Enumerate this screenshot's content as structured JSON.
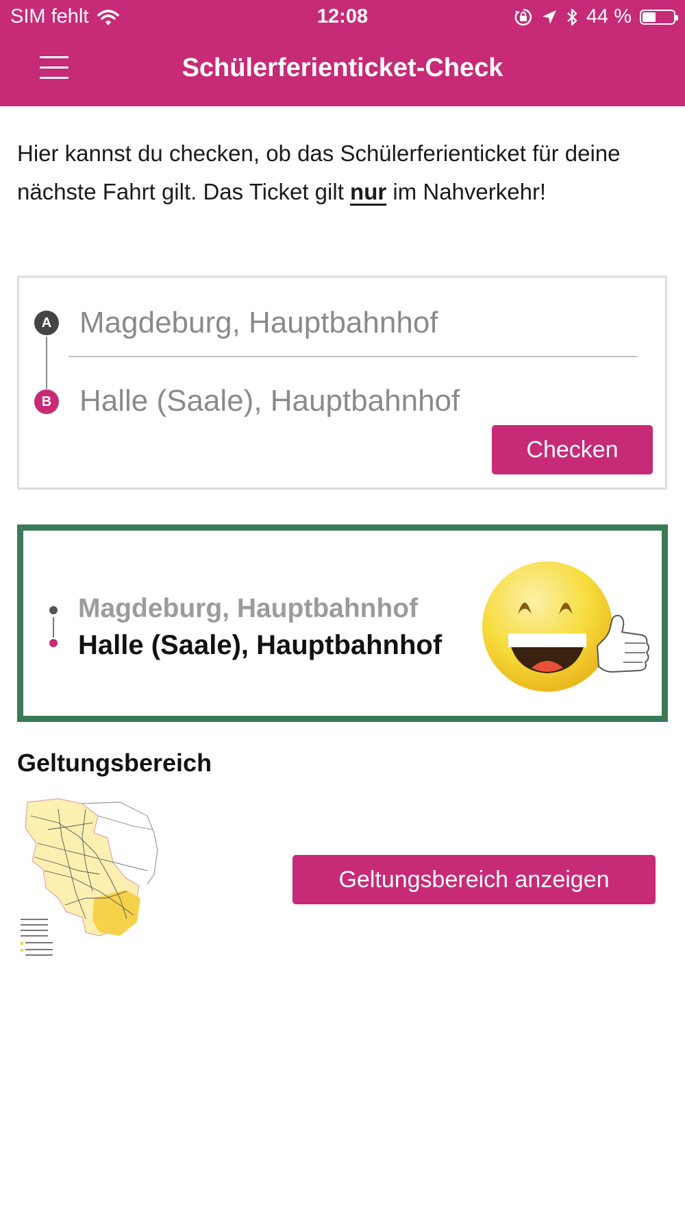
{
  "status_bar": {
    "carrier": "SIM fehlt",
    "time": "12:08",
    "battery_percent": "44 %",
    "battery_level": 0.44,
    "icons": [
      "wifi-icon",
      "rotation-lock-icon",
      "location-arrow-icon",
      "bluetooth-icon",
      "battery-icon"
    ]
  },
  "header": {
    "title": "Schülerferienticket-Check",
    "menu_icon": "hamburger-menu-icon"
  },
  "intro": {
    "text_before": "Hier kannst du checken, ob das Schülerferienticket für deine nächste Fahrt gilt. Das Ticket gilt ",
    "emphasis": "nur",
    "text_after": " im Nahverkehr!"
  },
  "route_form": {
    "marker_a": "A",
    "marker_b": "B",
    "from_value": "Magdeburg, Hauptbahnhof",
    "to_value": "Halle (Saale), Hauptbahnhof",
    "submit_label": "Checken"
  },
  "result": {
    "from": "Magdeburg, Hauptbahnhof",
    "to": "Halle (Saale), Hauptbahnhof",
    "status_icon": "laughing-thumbs-up-emoji-icon",
    "border_color": "#3b7a57"
  },
  "validity": {
    "title": "Geltungsbereich",
    "map_image": "validity-area-map-thumbnail",
    "button_label": "Geltungsbereich anzeigen"
  },
  "colors": {
    "brand": "#c72a77",
    "success": "#3b7a57"
  }
}
